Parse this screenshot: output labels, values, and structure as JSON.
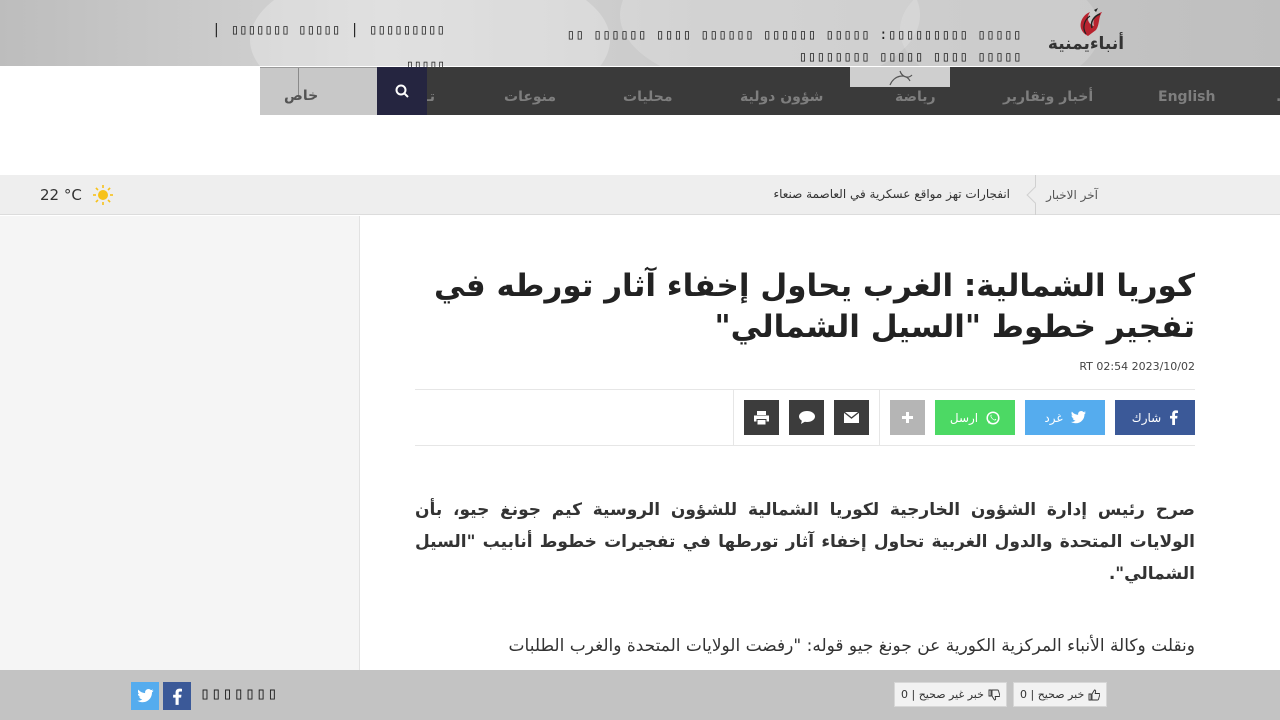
{
  "site": {
    "logo_text": "أنباءيمنية",
    "top_headline": "▯▯▯▯▯ ▯▯▯▯▯▯▯▯▯: ▯▯▯▯▯ ▯▯▯▯▯▯ ▯▯▯▯▯▯ ▯▯▯▯ ▯▯▯▯▯▯ ▯▯ ▯▯▯▯▯ ▯▯▯▯ ▯▯▯▯▯ ▯▯▯▯▯▯▯▯",
    "top_links": [
      "▯▯▯▯▯▯▯▯▯",
      "▯▯▯▯▯▯▯ ▯▯▯▯▯"
    ],
    "top_links_sub": "▯▯▯▯▯"
  },
  "nav": {
    "items": [
      "English",
      "أخبار وتقارير",
      "رياضة",
      "شؤون دولية",
      "محليات",
      "منوعات",
      "تـ"
    ],
    "special_label": "خاص"
  },
  "ticker": {
    "label": "آخر الاخبار",
    "text": "انفجارات تهز مواقع عسكرية في العاصمة صنعاء"
  },
  "weather": {
    "temp": "22 °C"
  },
  "article": {
    "title": "كوريا الشمالية: الغرب يحاول إخفاء آثار تورطه في تفجير خطوط \"السيل الشمالي\"",
    "meta": "2023/10/02 02:54 RT",
    "share": {
      "facebook": "شارك",
      "twitter": "غرد",
      "whatsapp": "ارسل"
    },
    "paragraphs": [
      "صرح رئيس إدارة الشؤون الخارجية لكوريا الشمالية للشؤون الروسية كيم جونغ جيو، بأن الولايات المتحدة والدول الغربية تحاول إخفاء آثار تورطها في تفجيرات خطوط أنابيب \"السيل الشمالي\".",
      "ونقلت وكالة الأنباء المركزية الكورية عن جونغ جيو قوله: \"رفضت الولايات المتحدة والغرب الطلبات"
    ]
  },
  "footer": {
    "follow_label": "▯▯▯▯▯▯▯",
    "vote_true": "خبر صحيح | 0",
    "vote_false": "خبر غير صحيح | 0"
  },
  "colors": {
    "nav_bg": "#3a3a3a",
    "facebook": "#3b5998",
    "twitter": "#55acee",
    "whatsapp": "#4cd964"
  }
}
